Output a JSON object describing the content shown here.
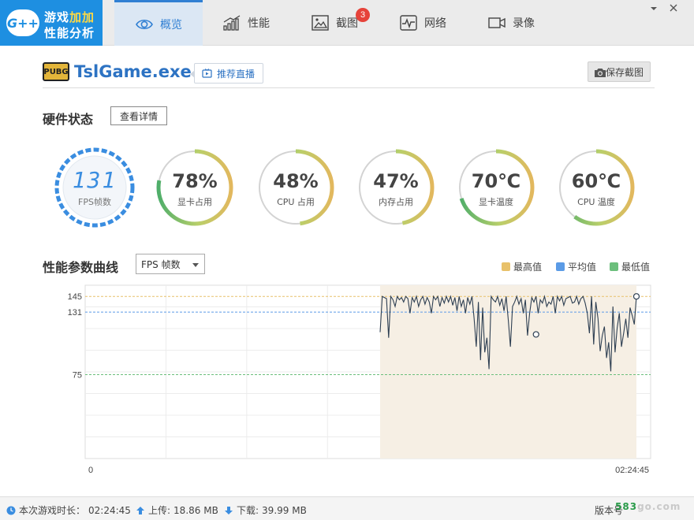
{
  "app": {
    "logo_text": "G++",
    "logo_line1_a": "游戏",
    "logo_line1_b": "加加",
    "logo_line2": "性能分析"
  },
  "tabs": [
    {
      "label": "概览",
      "icon": "eye-icon",
      "active": true
    },
    {
      "label": "性能",
      "icon": "bar-chart-icon",
      "active": false
    },
    {
      "label": "截图",
      "icon": "image-icon",
      "active": false,
      "badge": "3"
    },
    {
      "label": "网络",
      "icon": "pulse-icon",
      "active": false
    },
    {
      "label": "录像",
      "icon": "video-camera-icon",
      "active": false
    }
  ],
  "game": {
    "icon_text": "PUBG",
    "name": "TslGame.exe",
    "live_button": "推荐直播",
    "save_button": "保存截图"
  },
  "hardware": {
    "title": "硬件状态",
    "detail_button": "查看详情",
    "gauges": [
      {
        "id": "fps",
        "value": "131",
        "label": "FPS帧数"
      },
      {
        "id": "gpu-usage",
        "value": "78%",
        "label": "显卡占用",
        "fraction": 0.78
      },
      {
        "id": "cpu-usage",
        "value": "48%",
        "label": "CPU 占用",
        "fraction": 0.48
      },
      {
        "id": "mem-usage",
        "value": "47%",
        "label": "内存占用",
        "fraction": 0.47
      },
      {
        "id": "gpu-temp",
        "value": "70℃",
        "label": "显卡温度",
        "fraction": 0.7
      },
      {
        "id": "cpu-temp",
        "value": "60℃",
        "label": "CPU 温度",
        "fraction": 0.6
      }
    ]
  },
  "curve": {
    "title": "性能参数曲线",
    "select_value": "FPS 帧数",
    "legend": [
      {
        "label": "最高值",
        "color": "#e8c16a"
      },
      {
        "label": "平均值",
        "color": "#5b9be6"
      },
      {
        "label": "最低值",
        "color": "#6cbf7c"
      }
    ]
  },
  "chart_data": {
    "type": "line",
    "y_ticks": [
      145,
      131,
      75
    ],
    "max": 145,
    "avg": 131,
    "min": 75,
    "ylim": [
      0,
      155
    ],
    "x_start_label": "0",
    "x_end_label": "02:24:45",
    "line_color": "#2e3f52",
    "fill_color": "#f6efe4",
    "series": [
      {
        "values": [
          113,
          145,
          144,
          143,
          108,
          145,
          142,
          136,
          145,
          142,
          144,
          140,
          145,
          143,
          130,
          144,
          140,
          145,
          136,
          142,
          145,
          138,
          144,
          140,
          130,
          145,
          142,
          145,
          136,
          144,
          139,
          145,
          140,
          145,
          137,
          144,
          132,
          145,
          136,
          142,
          130,
          144,
          138,
          145,
          125,
          100,
          140,
          88,
          135,
          95,
          108,
          80,
          145,
          142,
          140,
          145,
          137,
          143,
          132,
          145,
          124,
          100,
          136,
          140,
          145,
          138,
          143,
          130,
          142,
          110,
          130,
          144,
          140,
          145,
          130,
          142,
          139,
          145,
          136,
          140,
          138,
          145,
          130,
          145,
          141,
          145,
          137,
          143,
          144,
          145,
          139,
          140,
          145,
          138,
          143,
          145,
          139,
          130,
          112,
          145,
          102,
          140,
          125,
          96,
          110,
          118,
          90,
          104,
          78,
          136,
          95,
          117,
          130,
          100,
          112,
          125,
          108,
          135,
          128,
          120,
          145
        ]
      }
    ],
    "markers": [
      {
        "index": 73,
        "value": 111
      },
      {
        "index": 120,
        "value": 145
      }
    ]
  },
  "status": {
    "session_label": "本次游戏时长：",
    "session_value": "02:24:45",
    "upload_label": "上传:",
    "upload_value": "18.86 MB",
    "download_label": "下载:",
    "download_value": "39.99 MB",
    "version_label": "版本号"
  },
  "watermark": {
    "text_a": "583",
    "text_b": "go.com"
  }
}
